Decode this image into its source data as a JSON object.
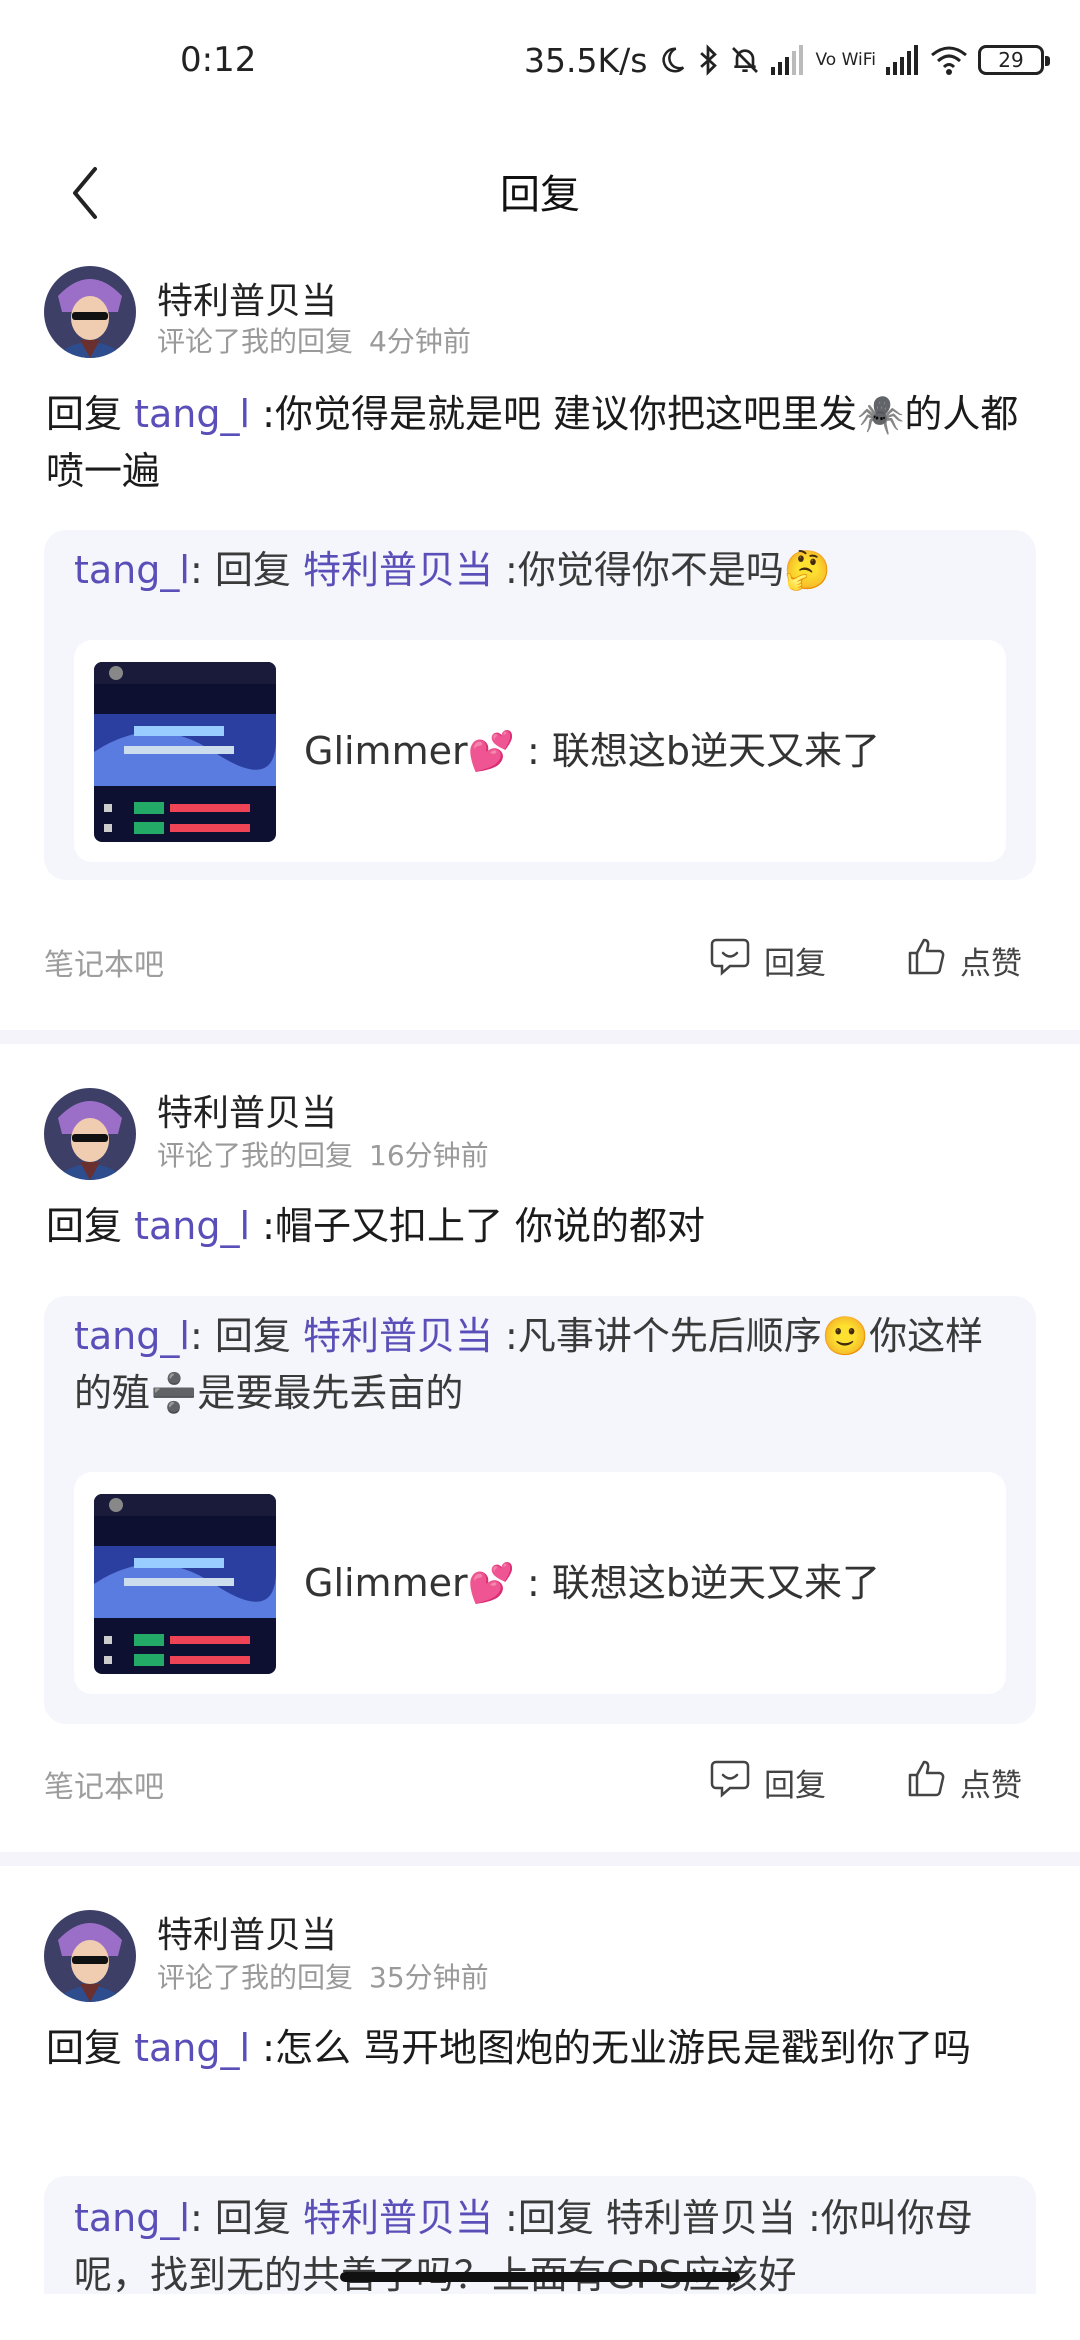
{
  "status_bar": {
    "time": "0:12",
    "net_speed": "35.5K/s",
    "vowifi": "Vo WiFi",
    "battery": "29",
    "icons": [
      "moon-icon",
      "bluetooth-icon",
      "bell-off-icon",
      "signal-icon",
      "vowifi-icon",
      "signal-r-icon",
      "wifi-icon",
      "battery-icon"
    ]
  },
  "header": {
    "title": "回复",
    "back_icon": "chevron-left-icon"
  },
  "notifications": [
    {
      "username": "特利普贝当",
      "action": "评论了我的回复",
      "time": "4分钟前",
      "reply_prefix": "回复",
      "reply_mention": "tang_l",
      "reply_text": ":你觉得是就是吧 建议你把这吧里发🕷️的人都喷一遍",
      "quote": {
        "author": "tang_l",
        "sep": ": 回复",
        "mention": "特利普贝当",
        "text": ":你觉得你不是吗🤔"
      },
      "origin": {
        "author": "Glimmer💕",
        "text": ": 联想这b逆天又来了"
      },
      "source": "笔记本吧",
      "reply_label": "回复",
      "like_label": "点赞"
    },
    {
      "username": "特利普贝当",
      "action": "评论了我的回复",
      "time": "16分钟前",
      "reply_prefix": "回复",
      "reply_mention": "tang_l",
      "reply_text": ":帽子又扣上了 你说的都对",
      "quote": {
        "author": "tang_l",
        "sep": ": 回复",
        "mention": "特利普贝当",
        "text": ":凡事讲个先后顺序🙂你这样的殖➗是要最先丢亩的"
      },
      "origin": {
        "author": "Glimmer💕",
        "text": ": 联想这b逆天又来了"
      },
      "source": "笔记本吧",
      "reply_label": "回复",
      "like_label": "点赞"
    },
    {
      "username": "特利普贝当",
      "action": "评论了我的回复",
      "time": "35分钟前",
      "reply_prefix": "回复",
      "reply_mention": "tang_l",
      "reply_text": ":怎么 骂开地图炮的无业游民是戳到你了吗",
      "quote": {
        "author": "tang_l",
        "sep": ": 回复",
        "mention": "特利普贝当",
        "text": ":回复 特利普贝当 :你叫你母呢，找到无的共善了吗？上面有GPS应该好"
      }
    }
  ],
  "colors": {
    "accent": "#5a4fb8",
    "quote_bg": "#f5f5fc",
    "separator": "#f4f4fa",
    "muted": "#9a9a9a"
  }
}
